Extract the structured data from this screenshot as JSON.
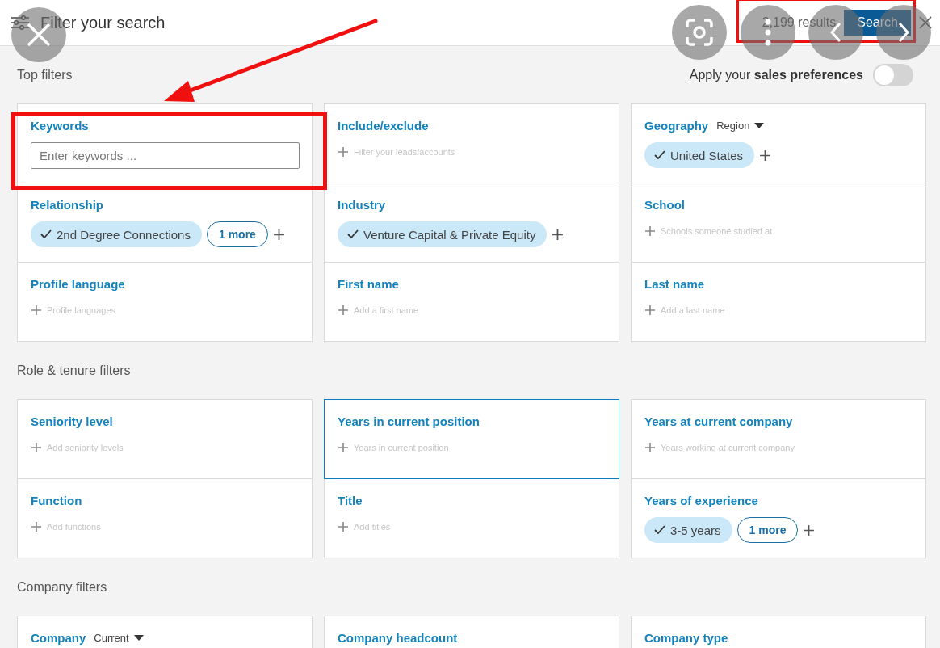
{
  "header": {
    "title": "Filter your search",
    "results": "2,199 results",
    "search_button": "Search"
  },
  "preferences": {
    "label": "Apply your **sales preferences**",
    "on": false
  },
  "sections": [
    {
      "title": "Top filters",
      "cells": [
        {
          "kind": "input",
          "label": "Keywords",
          "placeholder": "Enter keywords ...",
          "focused": false
        },
        {
          "kind": "add",
          "label": "Include/exclude",
          "hint": "Filter your leads/accounts",
          "focused": false
        },
        {
          "kind": "chips",
          "label": "Geography",
          "dropdown": "Region",
          "chips": [
            {
              "label": "United States",
              "checked": true
            }
          ],
          "focused": false
        },
        {
          "kind": "chips",
          "label": "Relationship",
          "chips": [
            {
              "label": "2nd Degree Connections",
              "checked": true
            }
          ],
          "more": "1 more",
          "focused": false
        },
        {
          "kind": "chips",
          "label": "Industry",
          "chips": [
            {
              "label": "Venture Capital & Private Equity",
              "checked": true
            }
          ],
          "focused": false
        },
        {
          "kind": "add",
          "label": "School",
          "hint": "Schools someone studied at",
          "focused": false
        },
        {
          "kind": "add",
          "label": "Profile language",
          "hint": "Profile languages",
          "focused": false
        },
        {
          "kind": "add",
          "label": "First name",
          "hint": "Add a first name",
          "focused": false
        },
        {
          "kind": "add",
          "label": "Last name",
          "hint": "Add a last name",
          "focused": false
        }
      ]
    },
    {
      "title": "Role & tenure filters",
      "cells": [
        {
          "kind": "add",
          "label": "Seniority level",
          "hint": "Add seniority levels",
          "focused": false
        },
        {
          "kind": "add",
          "label": "Years in current position",
          "hint": "Years in current position",
          "focused": true
        },
        {
          "kind": "add",
          "label": "Years at current company",
          "hint": "Years working at current company",
          "focused": false
        },
        {
          "kind": "add",
          "label": "Function",
          "hint": "Add functions",
          "focused": false
        },
        {
          "kind": "add",
          "label": "Title",
          "hint": "Add titles",
          "focused": false
        },
        {
          "kind": "chips",
          "label": "Years of experience",
          "chips": [
            {
              "label": "3-5 years",
              "checked": true
            }
          ],
          "more": "1 more",
          "focused": false
        }
      ]
    },
    {
      "title": "Company filters",
      "cells": [
        {
          "kind": "label",
          "label": "Company",
          "dropdown": "Current",
          "focused": false
        },
        {
          "kind": "label",
          "label": "Company headcount",
          "focused": false
        },
        {
          "kind": "label",
          "label": "Company type",
          "focused": false
        }
      ]
    }
  ]
}
